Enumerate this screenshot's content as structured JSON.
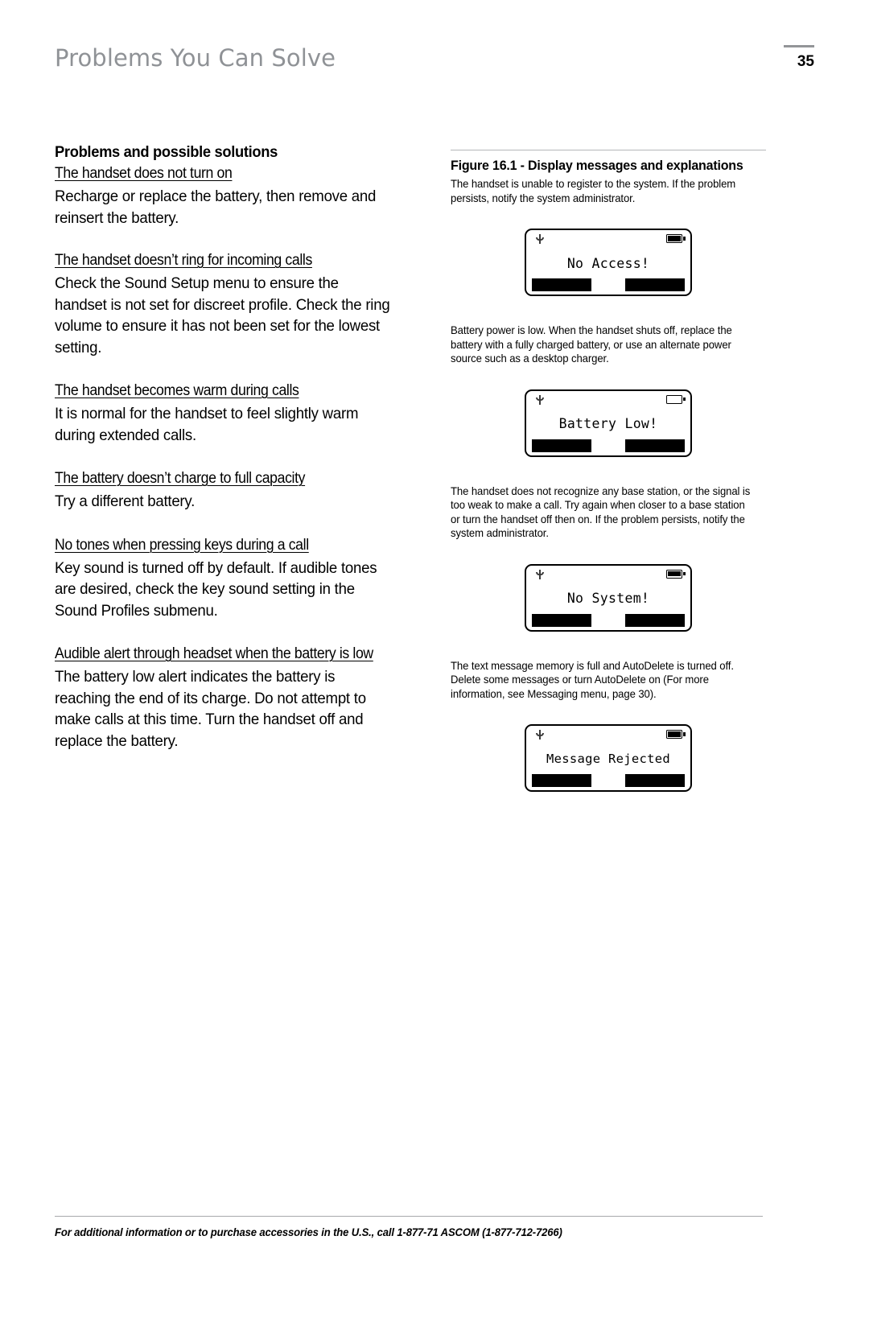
{
  "header": {
    "title": "Problems You Can Solve",
    "page_number": "35"
  },
  "left_column": {
    "section_title": "Problems and possible solutions",
    "problems": [
      {
        "heading": "The handset does not turn on",
        "body": "Recharge or replace the battery, then remove and reinsert the battery."
      },
      {
        "heading": "The handset doesn’t ring for incoming calls",
        "body": "Check the Sound Setup menu to ensure the handset is not set for discreet profile. Check the ring volume to ensure it has not been set for the lowest setting."
      },
      {
        "heading": "The handset becomes warm during calls",
        "body": "It is normal for the handset to feel slightly warm during extended calls."
      },
      {
        "heading": "The battery doesn’t charge to full capacity",
        "body": "Try a different battery."
      },
      {
        "heading": "No tones when pressing keys during a call",
        "body": "Key sound is turned off by default. If audible tones are desired, check the key sound setting in the Sound Profiles submenu."
      },
      {
        "heading": "Audible alert through headset when the battery is low",
        "body": "The battery low alert indicates the battery is reaching the end of its charge. Do not attempt to make calls at this time. Turn the handset off and replace the battery."
      }
    ]
  },
  "right_column": {
    "figure_title": "Figure 16.1 - Display messages and explanations",
    "entries": [
      {
        "caption": "The handset is unable to register to the system. If the problem persists, notify the system administrator.",
        "display": {
          "message": "No Access!",
          "signal_icon": "antenna-icon",
          "battery_icon": "battery-full-icon",
          "battery_state": "full",
          "softkey_left": "",
          "softkey_right": ""
        }
      },
      {
        "caption": "Battery power is low. When the handset shuts off, replace the battery with a fully charged battery, or use an alternate power source such as a desktop charger.",
        "display": {
          "message": "Battery Low!",
          "signal_icon": "antenna-icon",
          "battery_icon": "battery-empty-icon",
          "battery_state": "empty",
          "softkey_left": "",
          "softkey_right": ""
        }
      },
      {
        "caption": "The handset does not recognize any base station, or the signal is too weak to make a call. Try again when closer to a base station or turn the handset off then on. If the problem persists, notify the system administrator.",
        "display": {
          "message": "No System!",
          "signal_icon": "antenna-icon",
          "battery_icon": "battery-full-icon",
          "battery_state": "full",
          "softkey_left": "",
          "softkey_right": ""
        }
      },
      {
        "caption": "The text message memory is full and AutoDelete is turned off. Delete some messages or turn AutoDelete on (For more information, see Messaging menu, page 30).",
        "display": {
          "message": "Message Rejected",
          "signal_icon": "antenna-icon",
          "battery_icon": "battery-full-icon",
          "battery_state": "full",
          "softkey_left": "",
          "softkey_right": ""
        }
      }
    ]
  },
  "footer": {
    "text": "For additional information or to purchase accessories in the U.S., call 1-877-71 ASCOM (1-877-712-7266)"
  }
}
